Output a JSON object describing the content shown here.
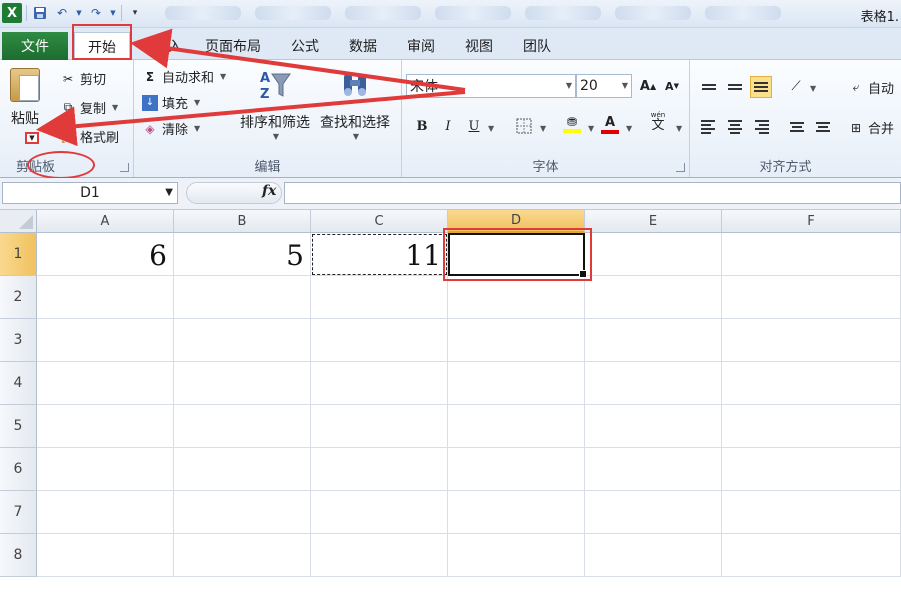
{
  "titlebar": {
    "doc_title": "表格1."
  },
  "tabs": {
    "file": "文件",
    "home": "开始",
    "insert": "插入",
    "page_layout": "页面布局",
    "formulas": "公式",
    "data": "数据",
    "review": "审阅",
    "view": "视图",
    "team": "团队"
  },
  "clipboard": {
    "paste": "粘贴",
    "cut": "剪切",
    "copy": "复制",
    "format_painter": "格式刷",
    "label": "剪贴板"
  },
  "editing": {
    "autosum": "自动求和",
    "fill": "填充",
    "clear": "清除",
    "sort_filter": "排序和筛选",
    "find_select": "查找和选择",
    "label": "编辑"
  },
  "font": {
    "name": "宋体",
    "size": "20",
    "label": "字体",
    "bold": "B",
    "italic": "I",
    "underline": "U",
    "phonetic": "wén",
    "phonetic_char": "文",
    "grow": "A",
    "shrink": "A"
  },
  "alignment": {
    "wrap": "自动",
    "merge": "合并",
    "label": "对齐方式"
  },
  "formula_bar": {
    "name_box": "D1",
    "fx": "fx",
    "content": ""
  },
  "grid": {
    "columns": [
      "A",
      "B",
      "C",
      "D",
      "E",
      "F"
    ],
    "rows": [
      "1",
      "2",
      "3",
      "4",
      "5",
      "6",
      "7",
      "8"
    ],
    "cells": {
      "A1": "6",
      "B1": "5",
      "C1": "11",
      "D1": ""
    },
    "selected_cell": "D1",
    "copy_source": "C1"
  },
  "colors": {
    "file_tab": "#1d6d30",
    "highlight": "#e03a3a",
    "selected_header": "#f1c15f",
    "fill_color": "#ffff00",
    "font_color": "#e00000"
  }
}
